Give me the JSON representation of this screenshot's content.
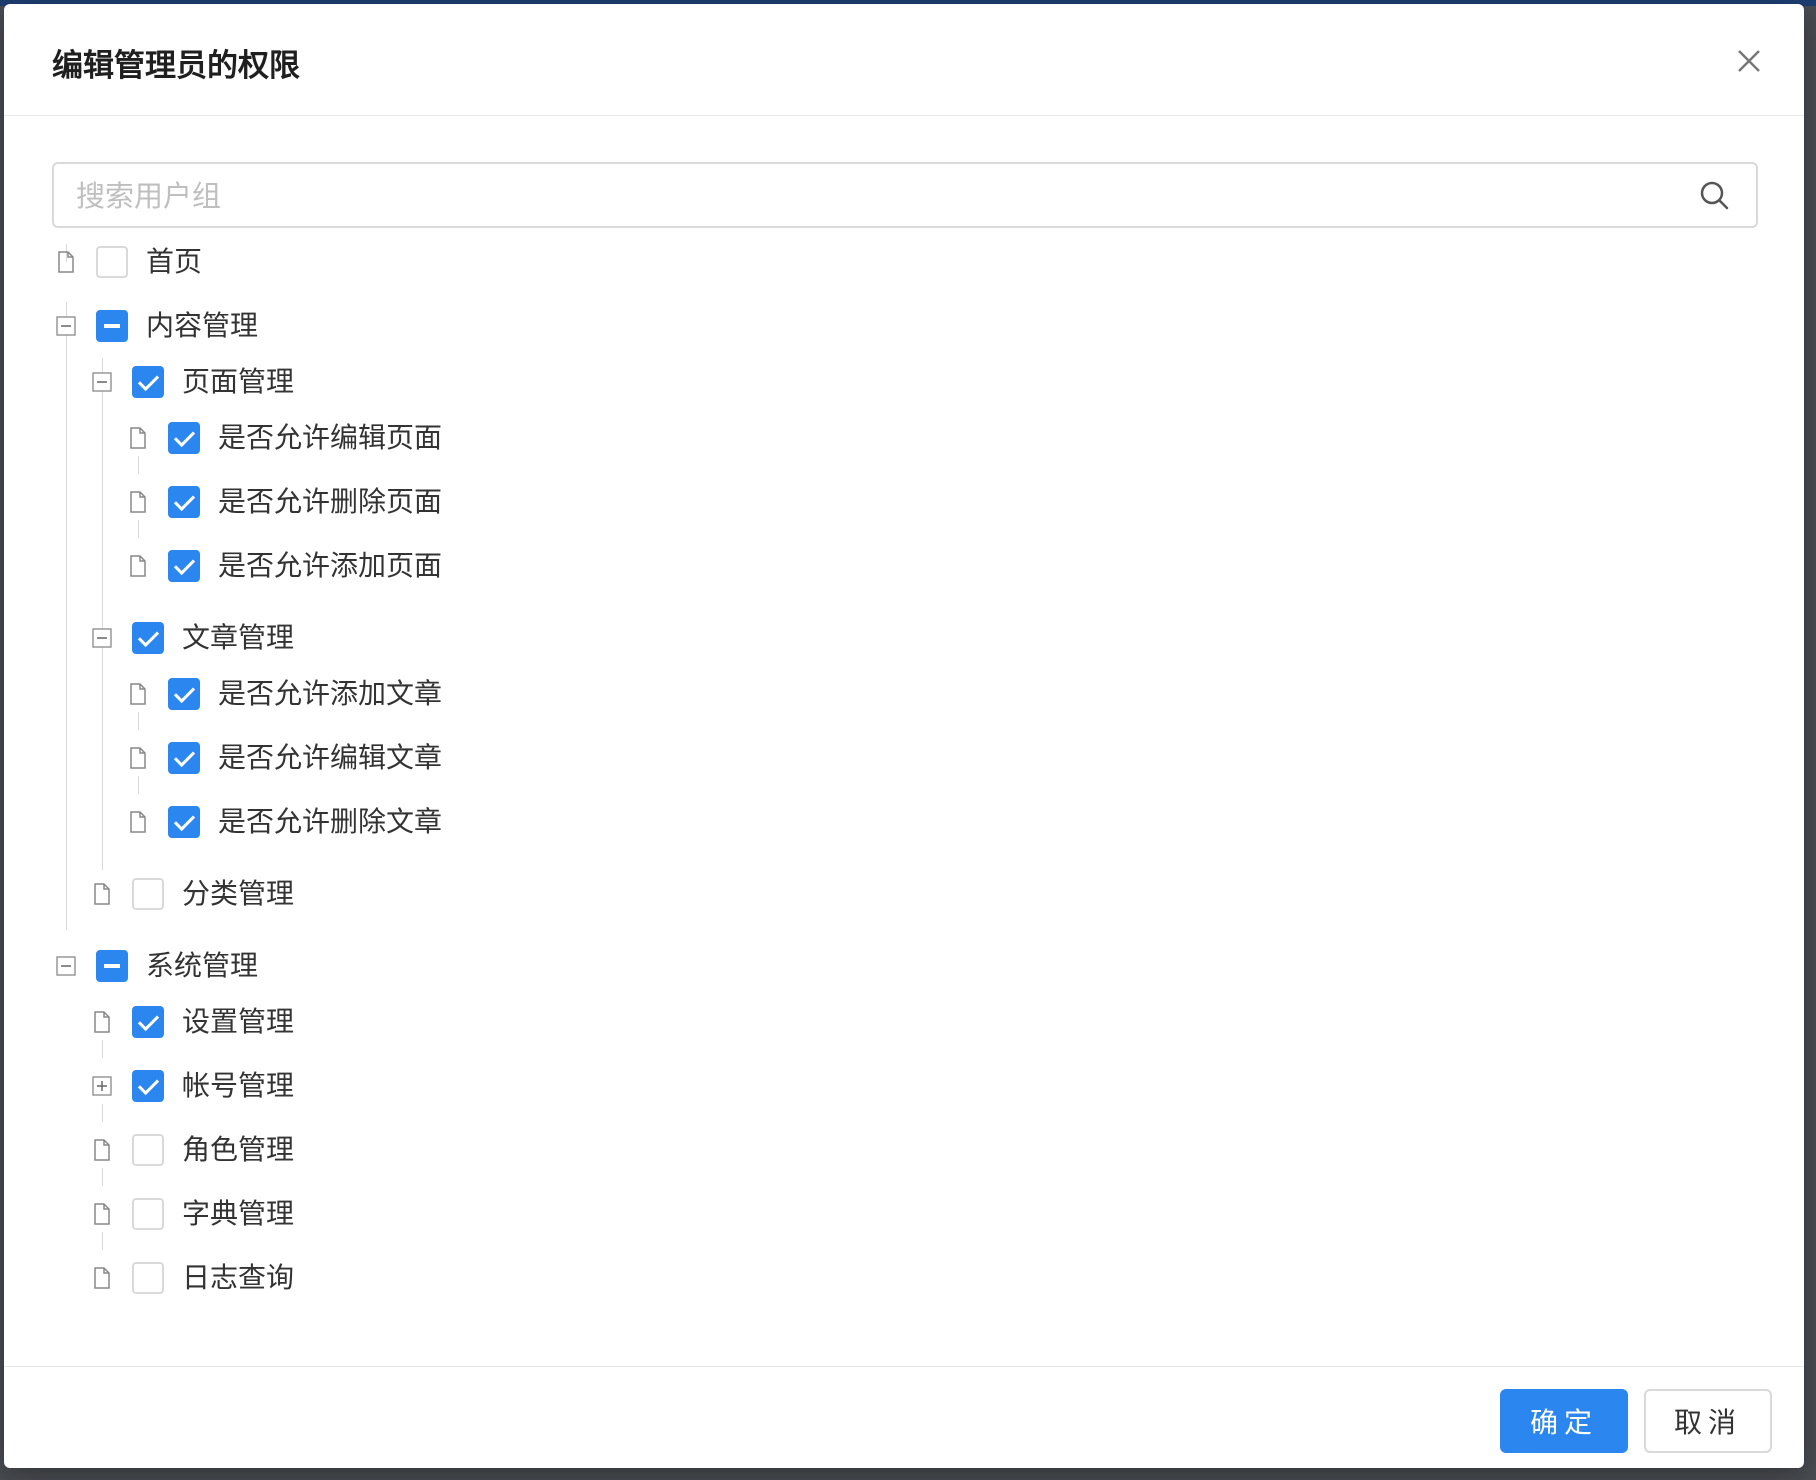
{
  "dialog": {
    "title": "编辑管理员的权限",
    "close_icon": "close-icon"
  },
  "search": {
    "placeholder": "搜索用户组",
    "value": ""
  },
  "tree": {
    "nodes": [
      {
        "label": "首页",
        "state": "unchecked",
        "switcher": "leaf"
      },
      {
        "label": "内容管理",
        "state": "indeterminate",
        "switcher": "expanded"
      },
      {
        "label": "页面管理",
        "state": "checked",
        "switcher": "expanded"
      },
      {
        "label": "是否允许编辑页面",
        "state": "checked",
        "switcher": "leaf"
      },
      {
        "label": "是否允许删除页面",
        "state": "checked",
        "switcher": "leaf"
      },
      {
        "label": "是否允许添加页面",
        "state": "checked",
        "switcher": "leaf"
      },
      {
        "label": "文章管理",
        "state": "checked",
        "switcher": "expanded"
      },
      {
        "label": "是否允许添加文章",
        "state": "checked",
        "switcher": "leaf"
      },
      {
        "label": "是否允许编辑文章",
        "state": "checked",
        "switcher": "leaf"
      },
      {
        "label": "是否允许删除文章",
        "state": "checked",
        "switcher": "leaf"
      },
      {
        "label": "分类管理",
        "state": "unchecked",
        "switcher": "leaf"
      },
      {
        "label": "系统管理",
        "state": "indeterminate",
        "switcher": "expanded"
      },
      {
        "label": "设置管理",
        "state": "checked",
        "switcher": "leaf"
      },
      {
        "label": "帐号管理",
        "state": "checked",
        "switcher": "collapsed"
      },
      {
        "label": "角色管理",
        "state": "unchecked",
        "switcher": "leaf"
      },
      {
        "label": "字典管理",
        "state": "unchecked",
        "switcher": "leaf"
      },
      {
        "label": "日志查询",
        "state": "unchecked",
        "switcher": "leaf"
      }
    ]
  },
  "footer": {
    "ok_label": "确定",
    "cancel_label": "取消"
  },
  "colors": {
    "accent": "#2c86f0",
    "border": "#d9d9d9"
  }
}
